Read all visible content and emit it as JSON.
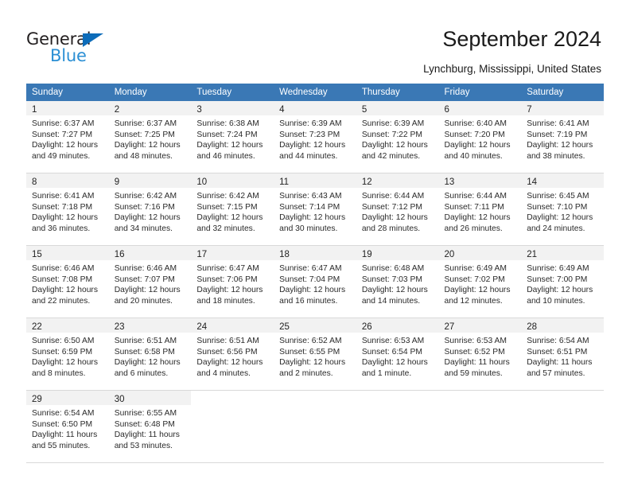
{
  "brand": {
    "name_part1": "General",
    "name_part2": "Blue",
    "accent_color": "#2b8fd4",
    "triangle_color": "#0d6cb9"
  },
  "header": {
    "title": "September 2024",
    "subtitle": "Lynchburg, Mississippi, United States"
  },
  "calendar": {
    "header_color": "#3a78b5",
    "weekdays": [
      "Sunday",
      "Monday",
      "Tuesday",
      "Wednesday",
      "Thursday",
      "Friday",
      "Saturday"
    ],
    "weeks": [
      [
        {
          "day": "1",
          "sunrise": "Sunrise: 6:37 AM",
          "sunset": "Sunset: 7:27 PM",
          "daylight1": "Daylight: 12 hours",
          "daylight2": "and 49 minutes."
        },
        {
          "day": "2",
          "sunrise": "Sunrise: 6:37 AM",
          "sunset": "Sunset: 7:25 PM",
          "daylight1": "Daylight: 12 hours",
          "daylight2": "and 48 minutes."
        },
        {
          "day": "3",
          "sunrise": "Sunrise: 6:38 AM",
          "sunset": "Sunset: 7:24 PM",
          "daylight1": "Daylight: 12 hours",
          "daylight2": "and 46 minutes."
        },
        {
          "day": "4",
          "sunrise": "Sunrise: 6:39 AM",
          "sunset": "Sunset: 7:23 PM",
          "daylight1": "Daylight: 12 hours",
          "daylight2": "and 44 minutes."
        },
        {
          "day": "5",
          "sunrise": "Sunrise: 6:39 AM",
          "sunset": "Sunset: 7:22 PM",
          "daylight1": "Daylight: 12 hours",
          "daylight2": "and 42 minutes."
        },
        {
          "day": "6",
          "sunrise": "Sunrise: 6:40 AM",
          "sunset": "Sunset: 7:20 PM",
          "daylight1": "Daylight: 12 hours",
          "daylight2": "and 40 minutes."
        },
        {
          "day": "7",
          "sunrise": "Sunrise: 6:41 AM",
          "sunset": "Sunset: 7:19 PM",
          "daylight1": "Daylight: 12 hours",
          "daylight2": "and 38 minutes."
        }
      ],
      [
        {
          "day": "8",
          "sunrise": "Sunrise: 6:41 AM",
          "sunset": "Sunset: 7:18 PM",
          "daylight1": "Daylight: 12 hours",
          "daylight2": "and 36 minutes."
        },
        {
          "day": "9",
          "sunrise": "Sunrise: 6:42 AM",
          "sunset": "Sunset: 7:16 PM",
          "daylight1": "Daylight: 12 hours",
          "daylight2": "and 34 minutes."
        },
        {
          "day": "10",
          "sunrise": "Sunrise: 6:42 AM",
          "sunset": "Sunset: 7:15 PM",
          "daylight1": "Daylight: 12 hours",
          "daylight2": "and 32 minutes."
        },
        {
          "day": "11",
          "sunrise": "Sunrise: 6:43 AM",
          "sunset": "Sunset: 7:14 PM",
          "daylight1": "Daylight: 12 hours",
          "daylight2": "and 30 minutes."
        },
        {
          "day": "12",
          "sunrise": "Sunrise: 6:44 AM",
          "sunset": "Sunset: 7:12 PM",
          "daylight1": "Daylight: 12 hours",
          "daylight2": "and 28 minutes."
        },
        {
          "day": "13",
          "sunrise": "Sunrise: 6:44 AM",
          "sunset": "Sunset: 7:11 PM",
          "daylight1": "Daylight: 12 hours",
          "daylight2": "and 26 minutes."
        },
        {
          "day": "14",
          "sunrise": "Sunrise: 6:45 AM",
          "sunset": "Sunset: 7:10 PM",
          "daylight1": "Daylight: 12 hours",
          "daylight2": "and 24 minutes."
        }
      ],
      [
        {
          "day": "15",
          "sunrise": "Sunrise: 6:46 AM",
          "sunset": "Sunset: 7:08 PM",
          "daylight1": "Daylight: 12 hours",
          "daylight2": "and 22 minutes."
        },
        {
          "day": "16",
          "sunrise": "Sunrise: 6:46 AM",
          "sunset": "Sunset: 7:07 PM",
          "daylight1": "Daylight: 12 hours",
          "daylight2": "and 20 minutes."
        },
        {
          "day": "17",
          "sunrise": "Sunrise: 6:47 AM",
          "sunset": "Sunset: 7:06 PM",
          "daylight1": "Daylight: 12 hours",
          "daylight2": "and 18 minutes."
        },
        {
          "day": "18",
          "sunrise": "Sunrise: 6:47 AM",
          "sunset": "Sunset: 7:04 PM",
          "daylight1": "Daylight: 12 hours",
          "daylight2": "and 16 minutes."
        },
        {
          "day": "19",
          "sunrise": "Sunrise: 6:48 AM",
          "sunset": "Sunset: 7:03 PM",
          "daylight1": "Daylight: 12 hours",
          "daylight2": "and 14 minutes."
        },
        {
          "day": "20",
          "sunrise": "Sunrise: 6:49 AM",
          "sunset": "Sunset: 7:02 PM",
          "daylight1": "Daylight: 12 hours",
          "daylight2": "and 12 minutes."
        },
        {
          "day": "21",
          "sunrise": "Sunrise: 6:49 AM",
          "sunset": "Sunset: 7:00 PM",
          "daylight1": "Daylight: 12 hours",
          "daylight2": "and 10 minutes."
        }
      ],
      [
        {
          "day": "22",
          "sunrise": "Sunrise: 6:50 AM",
          "sunset": "Sunset: 6:59 PM",
          "daylight1": "Daylight: 12 hours",
          "daylight2": "and 8 minutes."
        },
        {
          "day": "23",
          "sunrise": "Sunrise: 6:51 AM",
          "sunset": "Sunset: 6:58 PM",
          "daylight1": "Daylight: 12 hours",
          "daylight2": "and 6 minutes."
        },
        {
          "day": "24",
          "sunrise": "Sunrise: 6:51 AM",
          "sunset": "Sunset: 6:56 PM",
          "daylight1": "Daylight: 12 hours",
          "daylight2": "and 4 minutes."
        },
        {
          "day": "25",
          "sunrise": "Sunrise: 6:52 AM",
          "sunset": "Sunset: 6:55 PM",
          "daylight1": "Daylight: 12 hours",
          "daylight2": "and 2 minutes."
        },
        {
          "day": "26",
          "sunrise": "Sunrise: 6:53 AM",
          "sunset": "Sunset: 6:54 PM",
          "daylight1": "Daylight: 12 hours",
          "daylight2": "and 1 minute."
        },
        {
          "day": "27",
          "sunrise": "Sunrise: 6:53 AM",
          "sunset": "Sunset: 6:52 PM",
          "daylight1": "Daylight: 11 hours",
          "daylight2": "and 59 minutes."
        },
        {
          "day": "28",
          "sunrise": "Sunrise: 6:54 AM",
          "sunset": "Sunset: 6:51 PM",
          "daylight1": "Daylight: 11 hours",
          "daylight2": "and 57 minutes."
        }
      ],
      [
        {
          "day": "29",
          "sunrise": "Sunrise: 6:54 AM",
          "sunset": "Sunset: 6:50 PM",
          "daylight1": "Daylight: 11 hours",
          "daylight2": "and 55 minutes."
        },
        {
          "day": "30",
          "sunrise": "Sunrise: 6:55 AM",
          "sunset": "Sunset: 6:48 PM",
          "daylight1": "Daylight: 11 hours",
          "daylight2": "and 53 minutes."
        },
        {
          "day": "",
          "sunrise": "",
          "sunset": "",
          "daylight1": "",
          "daylight2": ""
        },
        {
          "day": "",
          "sunrise": "",
          "sunset": "",
          "daylight1": "",
          "daylight2": ""
        },
        {
          "day": "",
          "sunrise": "",
          "sunset": "",
          "daylight1": "",
          "daylight2": ""
        },
        {
          "day": "",
          "sunrise": "",
          "sunset": "",
          "daylight1": "",
          "daylight2": ""
        },
        {
          "day": "",
          "sunrise": "",
          "sunset": "",
          "daylight1": "",
          "daylight2": ""
        }
      ]
    ]
  }
}
